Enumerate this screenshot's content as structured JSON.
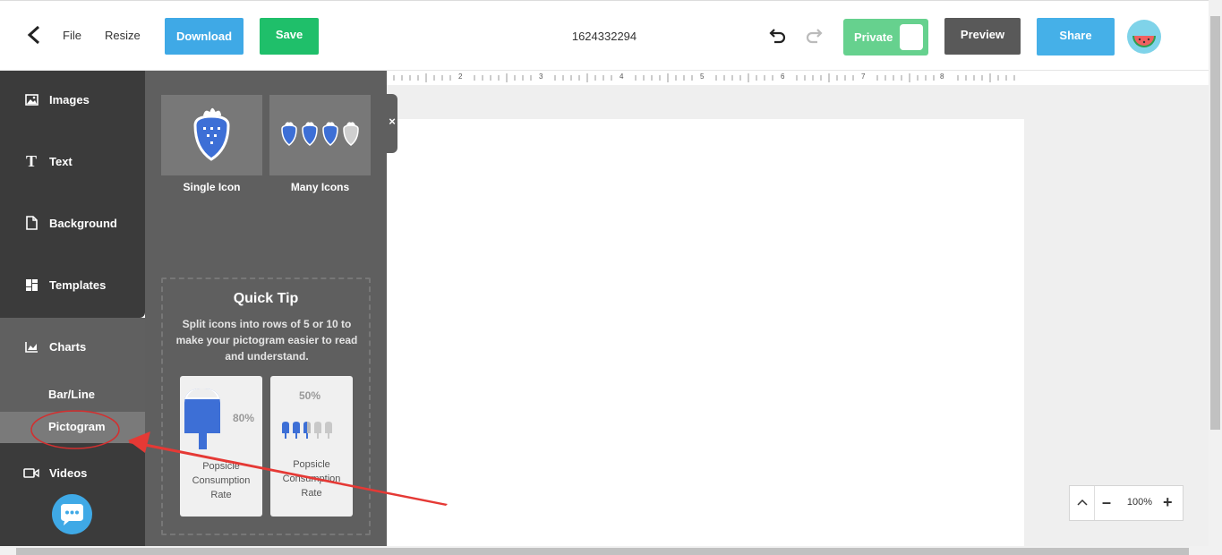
{
  "toolbar": {
    "file_label": "File",
    "resize_label": "Resize",
    "download_label": "Download",
    "save_label": "Save",
    "document_title": "1624332294",
    "private_label": "Private",
    "preview_label": "Preview",
    "share_label": "Share",
    "colors": {
      "download": "#3fa9e6",
      "save": "#1fbf6a",
      "private": "#66d18e",
      "preview": "#595959",
      "share": "#45b0e8"
    }
  },
  "sidebar": {
    "items": [
      {
        "label": "Images",
        "icon": "image-icon"
      },
      {
        "label": "Text",
        "icon": "text-icon"
      },
      {
        "label": "Background",
        "icon": "page-icon"
      },
      {
        "label": "Templates",
        "icon": "templates-icon"
      },
      {
        "label": "Charts",
        "icon": "chart-icon"
      },
      {
        "label": "Videos",
        "icon": "video-icon"
      }
    ],
    "chart_subitems": [
      "Bar/Line",
      "Pictogram"
    ],
    "selected": "Pictogram"
  },
  "panel": {
    "options": [
      {
        "label": "Single Icon",
        "icon": "strawberry-icon"
      },
      {
        "label": "Many Icons",
        "icon": "strawberries-icon"
      }
    ],
    "tip": {
      "title": "Quick Tip",
      "text": "Split icons into rows of 5 or 10 to make your pictogram easier to read and understand.",
      "cards": [
        {
          "percent": "80%",
          "caption": "Popsicle Consumption Rate"
        },
        {
          "percent": "50%",
          "caption": "Popsicle Consumption Rate"
        }
      ]
    },
    "close_label": "×"
  },
  "ruler": {
    "marks": [
      "2",
      "3",
      "4",
      "5",
      "6",
      "7",
      "8"
    ]
  },
  "zoom": {
    "level": "100%",
    "minus": "–",
    "plus": "+"
  },
  "accent_color": "#e53935"
}
